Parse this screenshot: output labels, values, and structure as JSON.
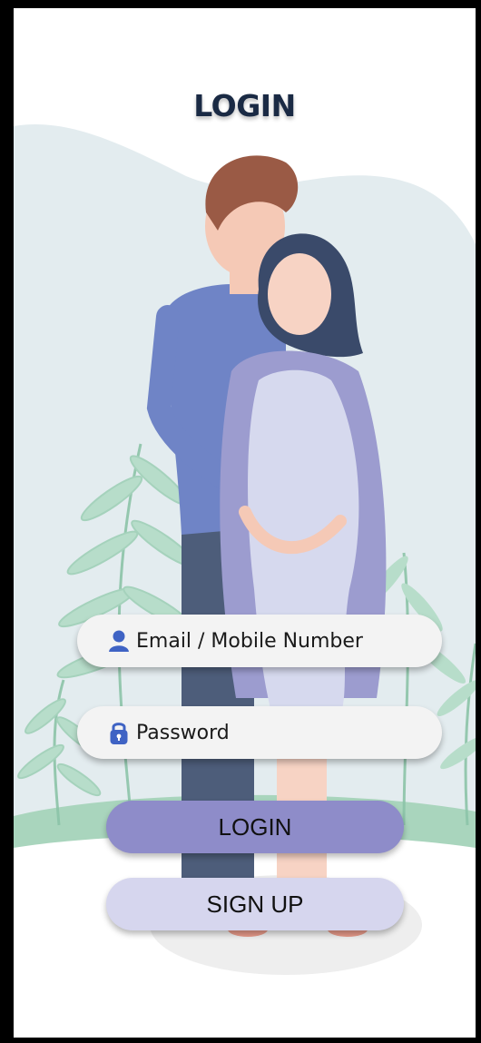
{
  "header": {
    "title": "LOGIN"
  },
  "form": {
    "email_placeholder": "Email / Mobile Number",
    "password_placeholder": "Password",
    "login_label": "LOGIN",
    "signup_label": "SIGN UP"
  },
  "icons": {
    "email_field_icon": "user-icon",
    "password_field_icon": "lock-icon"
  },
  "colors": {
    "login_button": "#8e8cc9",
    "signup_button": "#d6d6ee",
    "icon": "#3f63c4",
    "title": "#1a2a44",
    "background_blob": "#e3ecef"
  }
}
